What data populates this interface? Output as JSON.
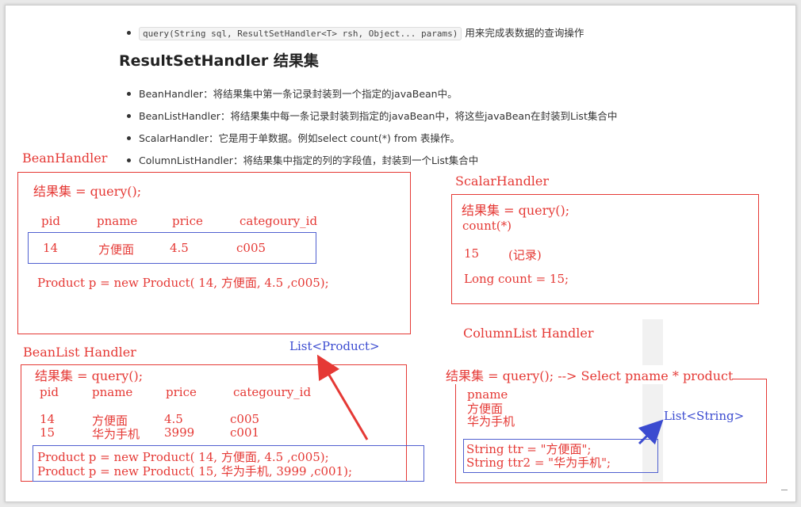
{
  "intro_bullet": {
    "code": "query(String sql, ResultSetHandler<T> rsh, Object... params)",
    "text": "用来完成表数据的查询操作"
  },
  "heading": "ResultSetHandler 结果集",
  "bullets": [
    "BeanHandler：将结果集中第一条记录封装到一个指定的javaBean中。",
    "BeanListHandler：将结果集中每一条记录封装到指定的javaBean中，将这些javaBean在封装到List集合中",
    "ScalarHandler：它是用于单数据。例如select count(*) from 表操作。",
    "ColumnListHandler：将结果集中指定的列的字段值，封装到一个List集合中"
  ],
  "bean_handler": {
    "title": "BeanHandler",
    "query": "结果集 = query();",
    "headers": [
      "pid",
      "pname",
      "price",
      "categoury_id"
    ],
    "row": [
      "14",
      "方便面",
      "4.5",
      "c005"
    ],
    "code": "Product p = new Product( 14, 方便面, 4.5 ,c005);"
  },
  "scalar_handler": {
    "title": "ScalarHandler",
    "query": "结果集 = query();",
    "count": "count(*)",
    "value": "15",
    "note": "(记录)",
    "code": "Long count = 15;"
  },
  "bean_list_handler": {
    "title": "BeanList Handler",
    "list_label": "List<Product>",
    "query": "结果集 = query();",
    "headers": [
      "pid",
      "pname",
      "price",
      "categoury_id"
    ],
    "rows": [
      [
        "14",
        "方便面",
        "4.5",
        "c005"
      ],
      [
        "15",
        "华为手机",
        "3999",
        "c001"
      ]
    ],
    "code_lines": [
      "Product p = new Product( 14, 方便面, 4.5 ,c005);",
      "Product p = new Product( 15, 华为手机, 3999 ,c001);"
    ]
  },
  "column_list_handler": {
    "title": "ColumnList Handler",
    "query": "结果集 = query();  --> Select pname * product",
    "column": "pname",
    "values": [
      "方便面",
      "华为手机"
    ],
    "list_label": "List<String>",
    "code_lines": [
      "String ttr = \"方便面\";",
      "String ttr2 = \"华为手机\";"
    ]
  },
  "colors": {
    "annotation_red": "#e53935",
    "annotation_blue": "#3b4bd0",
    "text": "#333333"
  }
}
